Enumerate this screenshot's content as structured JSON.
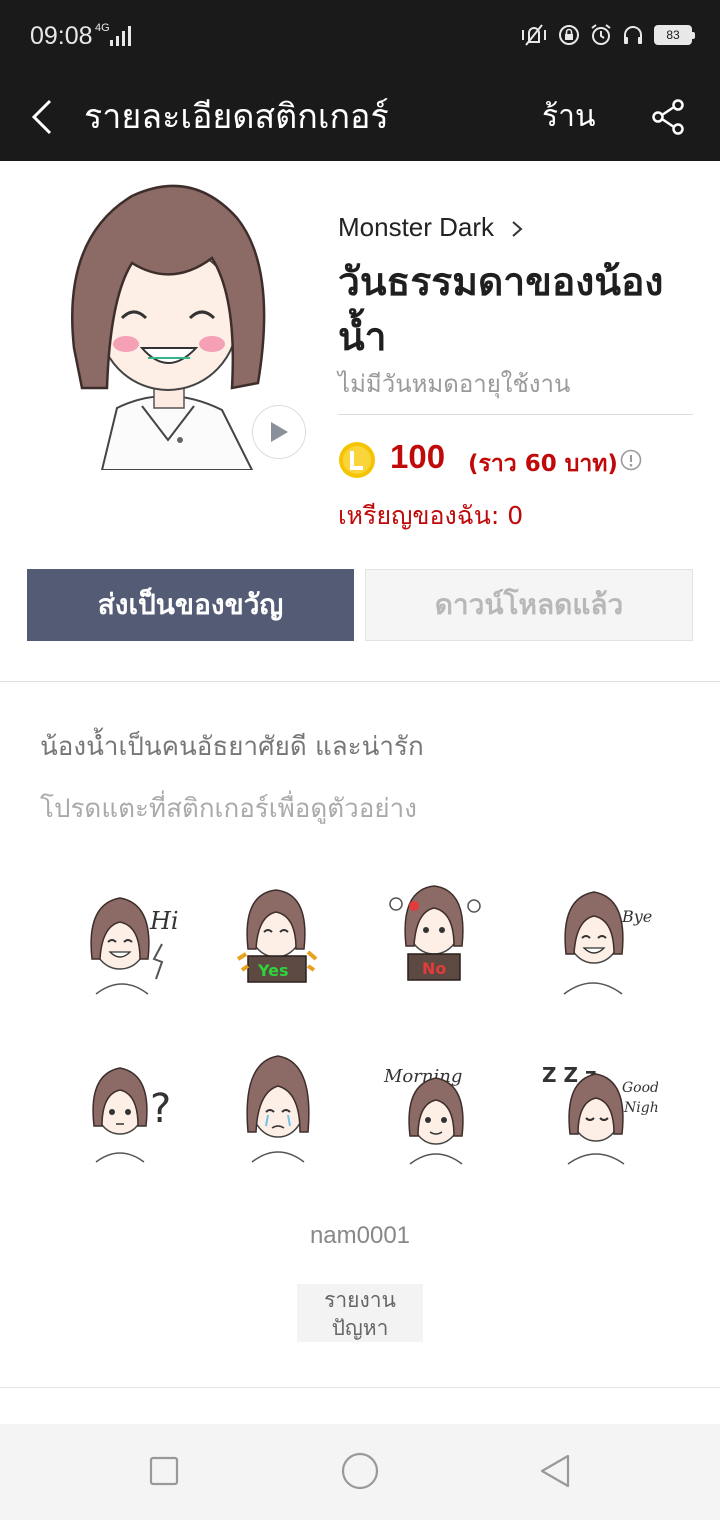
{
  "status_bar": {
    "time": "09:08",
    "network": "4G",
    "battery": "83"
  },
  "app_bar": {
    "title": "รายละเอียดสติกเกอร์",
    "shop_label": "ร้าน"
  },
  "sticker": {
    "author": "Monster Dark",
    "title": "วันธรรมดาของน้องน้ำ",
    "validity": "ไม่มีวันหมดอายุใช้งาน",
    "price": "100",
    "price_approx": "(ราว 60 บาท)",
    "my_coins": "เหรียญของฉัน: 0",
    "description": "น้องน้ำเป็นคนอัธยาศัยดี และน่ารัก",
    "tap_hint": "โปรดแตะที่สติกเกอร์เพื่อดูตัวอย่าง",
    "creator_id": "nam0001"
  },
  "buttons": {
    "gift": "ส่งเป็นของขวัญ",
    "downloaded": "ดาวน์โหลดแล้ว",
    "report": "รายงานปัญหา"
  },
  "sticker_texts": {
    "hi": "Hi",
    "yes": "Yes",
    "no": "No",
    "bye": "Bye",
    "question": "?",
    "morning": "Morning",
    "zzz": "Z Z z",
    "good": "Good",
    "night": "Night"
  },
  "colors": {
    "header_bg": "#1a1a1a",
    "gift_button": "#535b75",
    "price_red": "#c00a0a",
    "coin_yellow": "#f5c400",
    "hair_brown": "#8c6b66"
  },
  "icons": {
    "back": "back-arrow-icon",
    "share": "share-icon",
    "play": "play-icon",
    "coin": "coin-icon",
    "info": "info-icon",
    "chevron": "chevron-right-icon"
  }
}
